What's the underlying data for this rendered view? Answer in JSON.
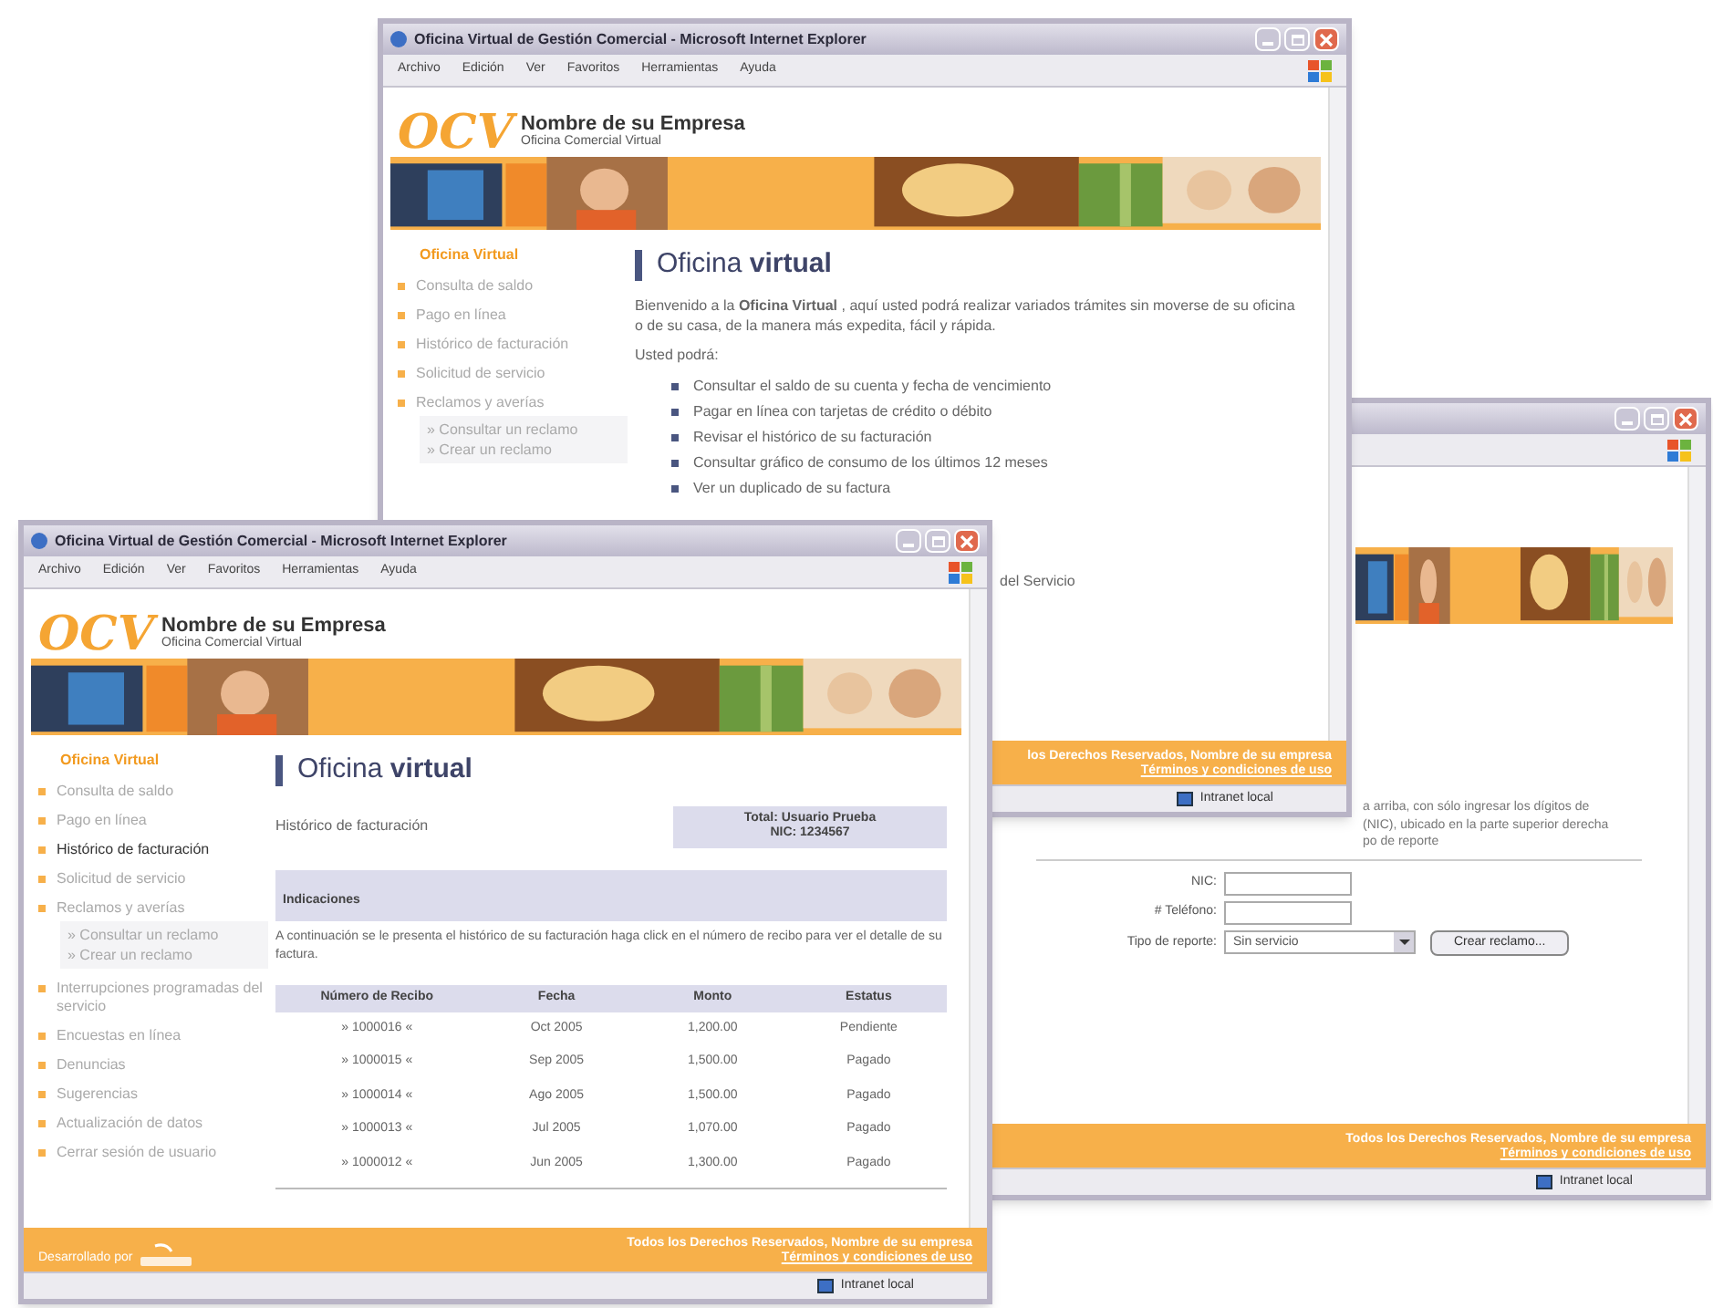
{
  "window_top": {
    "title": "Oficina Virtual de Gestión Comercial - Microsoft Internet Explorer",
    "menu": [
      "Archivo",
      "Edición",
      "Ver",
      "Favoritos",
      "Herramientas",
      "Ayuda"
    ],
    "logo": "OCV",
    "company": "Nombre de su Empresa",
    "tagline": "Oficina Comercial Virtual",
    "sidebar": {
      "title": "Oficina Virtual",
      "items": [
        {
          "label": "Consulta de saldo",
          "selected": false
        },
        {
          "label": "Pago en línea",
          "selected": false
        },
        {
          "label": "Histórico de facturación",
          "selected": false
        },
        {
          "label": "Solicitud de servicio",
          "selected": false
        },
        {
          "label": "Reclamos y averías",
          "selected": false,
          "children": [
            {
              "label": "» Consultar un reclamo"
            },
            {
              "label": "» Crear un reclamo"
            }
          ]
        }
      ]
    },
    "heading": "Oficina **virtual**",
    "intro": "Bienvenido a la **Oficina Virtual** , aquí usted podrá realizar variados trámites sin moverse de su oficina o de su casa, de la manera más expedita, fácil y rápida.",
    "lead": "Usted podrá:",
    "features": [
      "Consultar el saldo de su cuenta y fecha de vencimiento",
      "Pagar en línea con tarjetas de crédito o débito",
      "Revisar el histórico de su facturación",
      "Consultar gráfico de consumo de los últimos 12 meses",
      "Ver un duplicado de su factura"
    ],
    "feature_fragment": "del Servicio",
    "footer": {
      "rights": "los Derechos Reservados, Nombre de su empresa",
      "terms": "Términos y condiciones de uso"
    },
    "status": "Intranet local"
  },
  "window_right": {
    "intro_lines": [
      "a arriba, con sólo ingresar los dígitos de",
      "(NIC), ubicado en la parte superior derecha",
      "po de reporte"
    ],
    "form": {
      "fields": [
        {
          "label": "NIC:"
        },
        {
          "label": "# Teléfono:"
        }
      ],
      "select": {
        "label": "Tipo de reporte:",
        "value": "Sin servicio"
      },
      "button": "Crear reclamo..."
    },
    "footer": {
      "rights": "Todos los Derechos Reservados, Nombre de su empresa",
      "terms": "Términos y condiciones de uso"
    },
    "status": "Intranet local"
  },
  "window_front": {
    "title": "Oficina Virtual de Gestión Comercial - Microsoft Internet Explorer",
    "menu": [
      "Archivo",
      "Edición",
      "Ver",
      "Favoritos",
      "Herramientas",
      "Ayuda"
    ],
    "logo": "OCV",
    "company": "Nombre de su Empresa",
    "tagline": "Oficina Comercial Virtual",
    "sidebar": {
      "title": "Oficina Virtual",
      "items": [
        {
          "label": "Consulta de saldo",
          "selected": false
        },
        {
          "label": "Pago en línea",
          "selected": false
        },
        {
          "label": "Histórico de facturación",
          "selected": true
        },
        {
          "label": "Solicitud de servicio",
          "selected": false
        },
        {
          "label": "Reclamos y averías",
          "selected": false,
          "children": [
            {
              "label": "» Consultar un reclamo"
            },
            {
              "label": "» Crear un reclamo"
            }
          ]
        },
        {
          "label": "Interrupciones programadas del servicio",
          "selected": false
        },
        {
          "label": "Encuestas en línea",
          "selected": false
        },
        {
          "label": "Denuncias",
          "selected": false
        },
        {
          "label": "Sugerencias",
          "selected": false
        },
        {
          "label": "Actualización de datos",
          "selected": false
        },
        {
          "label": "Cerrar sesión de usuario",
          "selected": false
        }
      ]
    },
    "heading": "Oficina **virtual**",
    "subtitle": "Histórico de facturación",
    "user_box": [
      "Total: Usuario Prueba",
      "NIC: 1234567"
    ],
    "section": "Indicaciones",
    "instructions": "A continuación se le presenta el histórico de su facturación haga click en el número de recibo para ver el detalle de su factura.",
    "table": {
      "columns": [
        "Número de Recibo",
        "Fecha",
        "Monto",
        "Estatus"
      ],
      "rows": [
        [
          "» 1000016 «",
          "Oct 2005",
          "1,200.00",
          "Pendiente"
        ],
        [
          "» 1000015 «",
          "Sep 2005",
          "1,500.00",
          "Pagado"
        ],
        [
          "» 1000014 «",
          "Ago 2005",
          "1,500.00",
          "Pagado"
        ],
        [
          "» 1000013 «",
          "Jul 2005",
          "1,070.00",
          "Pagado"
        ],
        [
          "» 1000012 «",
          "Jun 2005",
          "1,300.00",
          "Pagado"
        ]
      ]
    },
    "footer": {
      "credit": "Desarrollado por",
      "rights": "Todos los Derechos Reservados, Nombre de su empresa",
      "terms": "Términos y condiciones de uso"
    },
    "status": "Intranet local"
  }
}
